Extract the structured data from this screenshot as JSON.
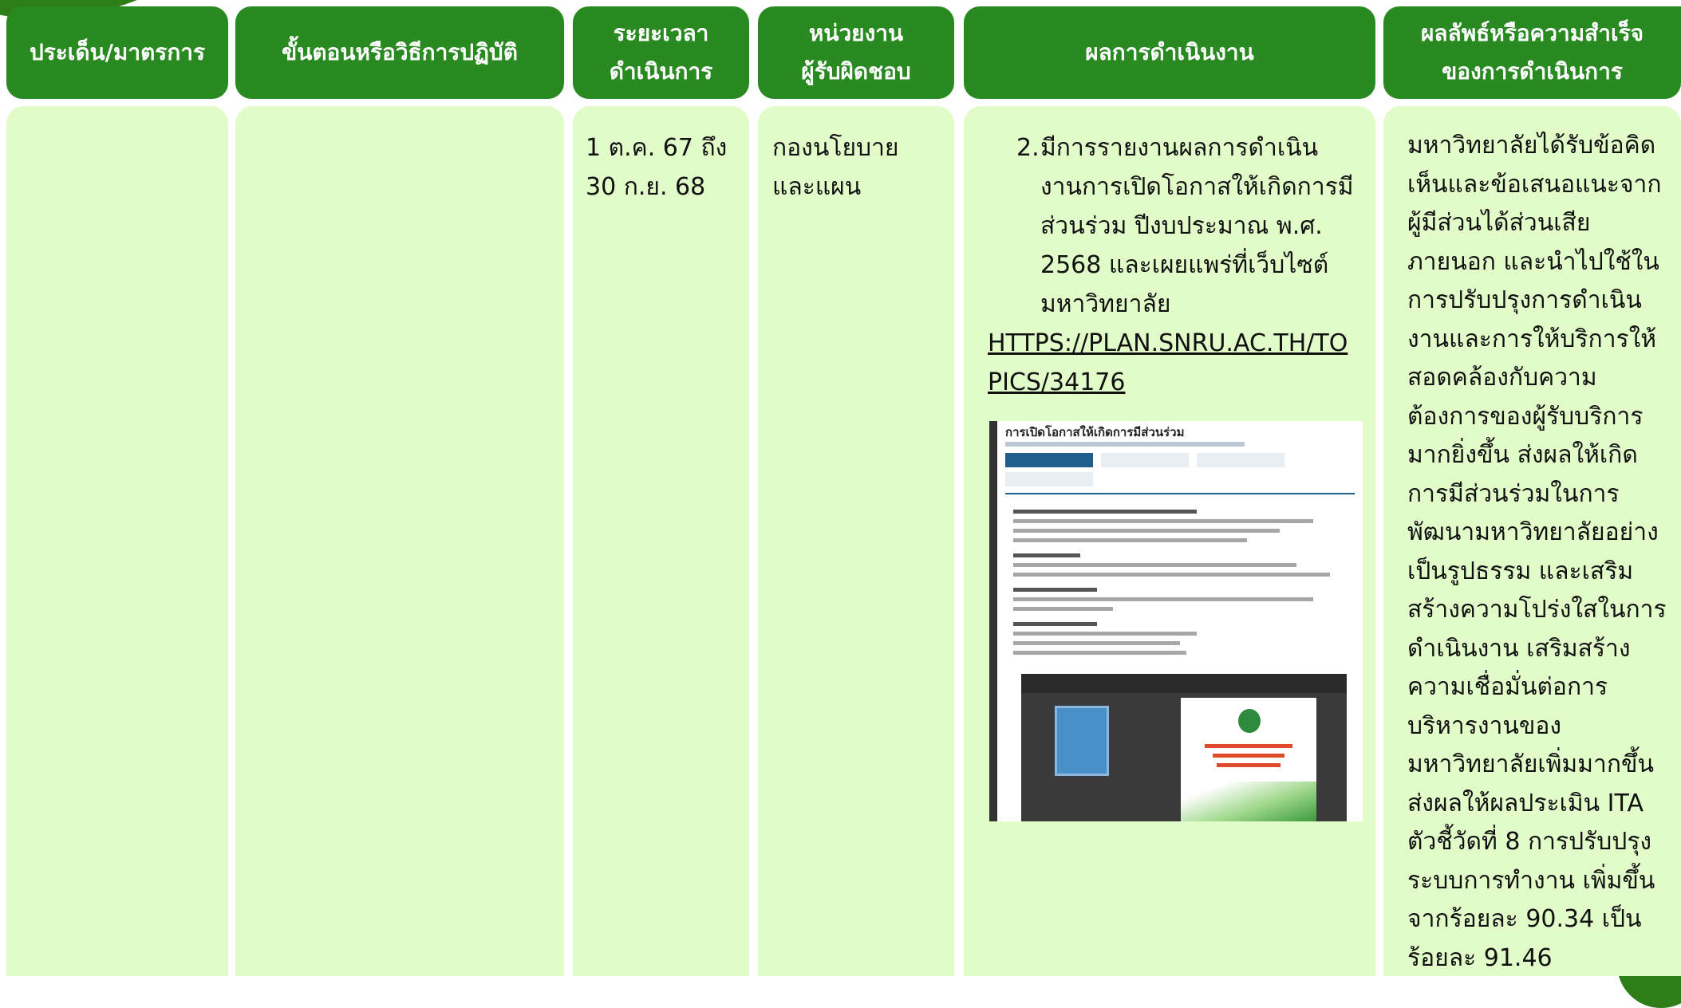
{
  "headers": {
    "issue": "ประเด็น/มาตรการ",
    "steps": "ขั้นตอนหรือวิธีการปฏิบัติ",
    "duration_line1": "ระยะเวลา",
    "duration_line2": "ดำเนินการ",
    "unit_line1": "หน่วยงาน",
    "unit_line2": "ผู้รับผิดชอบ",
    "results": "ผลการดำเนินงาน",
    "achievement_line1": "ผลลัพธ์หรือความสำเร็จ",
    "achievement_line2": "ของการดำเนินการ"
  },
  "row": {
    "issue": "",
    "steps": "",
    "duration": "1 ต.ค. 67 ถึง 30 ก.ย. 68",
    "unit": "กองนโยบายและแผน",
    "result_number": "2.",
    "result_text": "มีการรายงานผลการดำเนินงานการเปิดโอกาสให้เกิดการมีส่วนร่วม ปีงบประมาณ พ.ศ. 2568 และเผยแพร่ที่เว็บไซต์มหาวิทยาลัย",
    "result_link": "HTTPS://PLAN.SNRU.AC.TH/TOPICS/34176",
    "achievement": "มหาวิทยาลัยได้รับข้อคิดเห็นและข้อเสนอแนะจากผู้มีส่วนได้ส่วนเสียภายนอก และนำไปใช้ในการปรับปรุงการดำเนินงานและการให้บริการให้สอดคล้องกับความต้องการของผู้รับบริการมากยิ่งขึ้น ส่งผลให้เกิดการมีส่วนร่วมในการพัฒนามหาวิทยาลัยอย่างเป็นรูปธรรม และเสริมสร้างความโปร่งใสในการดำเนินงาน เสริมสร้างความเชื่อมั่นต่อการบริหารงานของมหาวิทยาลัยเพิ่มมากขึ้น ส่งผลให้ผลประเมิน ITA ตัวชี้วัดที่ 8 การปรับปรุงระบบการทำงาน เพิ่มขึ้นจากร้อยละ 90.34 เป็นร้อยละ 91.46"
  },
  "screenshot": {
    "title": "การเปิดโอกาสให้เกิดการมีส่วนร่วม"
  },
  "colors": {
    "header_green": "#2a8a22",
    "cell_green": "#e2fcc9",
    "corner_green": "#2e7d16"
  }
}
